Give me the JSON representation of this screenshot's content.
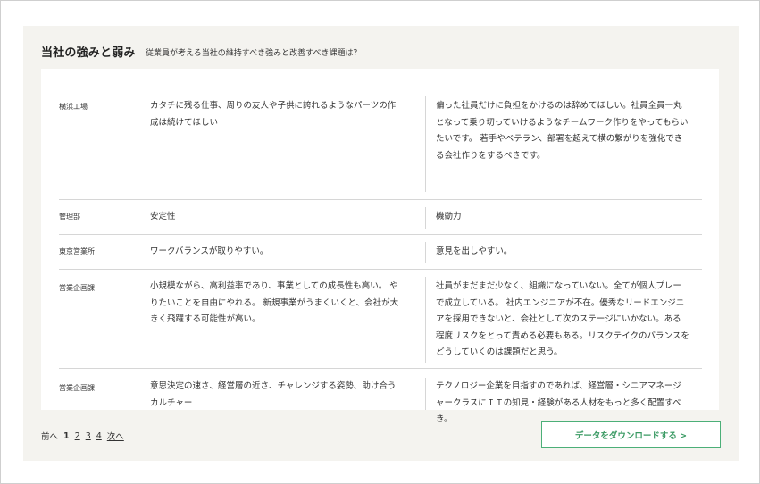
{
  "panel": {
    "title": "当社の強みと弱み",
    "subtitle": "従業員が考える当社の維持すべき強みと改善すべき課題は？"
  },
  "rows": [
    {
      "dept": "横浜工場",
      "strength": "カタチに残る仕事、周りの友人や子供に誇れるようなパーツの作\n成は続けてほしい",
      "weakness": "偏った社員だけに負担をかけるのは辞めてほしい。社員全員一丸\nとなって乗り切っていけるようなチームワーク作りをやってもらい\nたいです。 若手やベテラン、部署を超えて横の繋がりを強化でき\nる会社作りをするべきです。"
    },
    {
      "dept": "管理部",
      "strength": "安定性",
      "weakness": "機動力"
    },
    {
      "dept": "東京営業所",
      "strength": "ワークバランスが取りやすい。",
      "weakness": "意見を出しやすい。"
    },
    {
      "dept": "営業企画課",
      "strength": "小規模ながら、高利益率であり、事業としての成長性も高い。 や\nりたいことを自由にやれる。 新規事業がうまくいくと、会社が大\nきく飛躍する可能性が高い。",
      "weakness": "社員がまだまだ少なく、組織になっていない。全てが個人プレー\nで成立している。 社内エンジニアが不在。優秀なリードエンジニ\nアを採用できないと、会社として次のステージにいかない。ある\n程度リスクをとって責める必要もある。リスクテイクのバランスを\nどうしていくのは課題だと思う。"
    },
    {
      "dept": "営業企画課",
      "strength": "意思決定の速さ、経営層の近さ、チャレンジする姿勢、助け合う\nカルチャー",
      "weakness": "テクノロジー企業を目指すのであれば、経営層・シニアマネージ\nャークラスにＩＴの知見・経験がある人材をもっと多く配置すべ\nき。"
    }
  ],
  "pagination": {
    "prev": "前へ",
    "pages": [
      "1",
      "2",
      "3",
      "4"
    ],
    "current": "1",
    "next": "次へ"
  },
  "download_label": "データをダウンロードする >",
  "colors": {
    "panel_bg": "#f4f3ef",
    "accent": "#4caf78",
    "divider": "#d6d6d6"
  }
}
